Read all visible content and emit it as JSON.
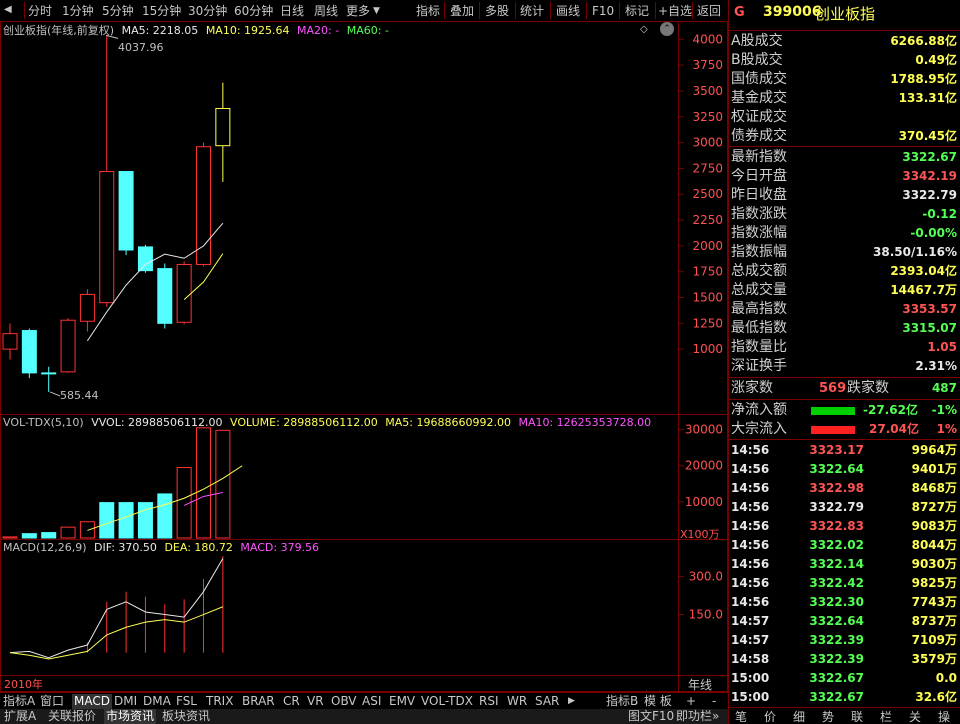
{
  "toolbar": {
    "left": [
      "分时",
      "1分钟",
      "5分钟",
      "15分钟",
      "30分钟",
      "60分钟",
      "日线",
      "周线",
      "更多"
    ],
    "right": [
      "指标",
      "叠加",
      "多股",
      "统计",
      "画线",
      "F10",
      "标记",
      "+自选",
      "返回"
    ]
  },
  "main_chart": {
    "title": "创业板指(年线,前复权)",
    "ma5": "MA5: 2218.05",
    "ma10": "MA10: 1925.64",
    "ma20": "MA20: -",
    "ma60": "MA60: -",
    "high_label": "4037.96",
    "low_label": "585.44",
    "y_ticks": [
      "4000",
      "3750",
      "3500",
      "3250",
      "3000",
      "2750",
      "2500",
      "2250",
      "2000",
      "1750",
      "1500",
      "1250",
      "1000"
    ]
  },
  "vol_chart": {
    "title": "VOL-TDX(5,10)",
    "vvol": "VVOL: 28988506112.00",
    "volume": "VOLUME: 28988506112.00",
    "ma5": "MA5: 19688660992.00",
    "ma10": "MA10: 12625353728.00",
    "y_ticks": [
      "30000",
      "20000",
      "10000"
    ],
    "unit": "X100万"
  },
  "macd_chart": {
    "title": "MACD(12,26,9)",
    "dif": "DIF: 370.50",
    "dea": "DEA: 180.72",
    "macd": "MACD: 379.56",
    "y_ticks": [
      "300.0",
      "150.0"
    ]
  },
  "x_axis": {
    "start_label": "2010年",
    "period_label": "年线"
  },
  "chart_data": [
    {
      "type": "candlestick",
      "title": "创业板指(年线,前复权)",
      "ylim": [
        585,
        4100
      ],
      "candles": [
        {
          "open": 1000,
          "high": 1250,
          "low": 900,
          "close": 1150,
          "color": "red"
        },
        {
          "open": 1180,
          "high": 1200,
          "low": 720,
          "close": 770,
          "color": "cyan"
        },
        {
          "open": 770,
          "high": 830,
          "low": 585.44,
          "close": 770,
          "color": "cyan"
        },
        {
          "open": 780,
          "high": 1300,
          "low": 770,
          "close": 1280,
          "color": "red"
        },
        {
          "open": 1270,
          "high": 1580,
          "low": 1170,
          "close": 1530,
          "color": "red"
        },
        {
          "open": 1450,
          "high": 4037.96,
          "low": 1410,
          "close": 2720,
          "color": "red"
        },
        {
          "open": 2720,
          "high": 2720,
          "low": 1910,
          "close": 1960,
          "color": "cyan"
        },
        {
          "open": 1990,
          "high": 2010,
          "low": 1740,
          "close": 1760,
          "color": "cyan"
        },
        {
          "open": 1780,
          "high": 1830,
          "low": 1200,
          "close": 1250,
          "color": "cyan"
        },
        {
          "open": 1260,
          "high": 1850,
          "low": 1240,
          "close": 1820,
          "color": "red"
        },
        {
          "open": 1820,
          "high": 3000,
          "low": 1800,
          "close": 2960,
          "color": "red"
        },
        {
          "open": 2970,
          "high": 3580,
          "low": 2620,
          "close": 3330,
          "color": "yellow"
        }
      ],
      "ma5_series": {
        "start_index": 4,
        "values": [
          1080,
          1360,
          1620,
          1820,
          1920,
          1880,
          2000,
          2220
        ]
      },
      "ma10_series": {
        "start_index": 9,
        "values": [
          1480,
          1650,
          1925
        ]
      }
    },
    {
      "type": "bar",
      "title": "VOL-TDX(5,10)",
      "ylim": [
        0,
        31000
      ],
      "values": [
        300,
        1200,
        1500,
        3000,
        4500,
        9800,
        9800,
        9800,
        12200,
        19500,
        30500,
        29800
      ],
      "colors": [
        "red",
        "cyan",
        "cyan",
        "red",
        "red",
        "cyan",
        "cyan",
        "cyan",
        "cyan",
        "red",
        "red",
        "red"
      ],
      "ma5_series": {
        "start_index": 4,
        "values": [
          2100,
          4000,
          5800,
          7800,
          9200,
          11000,
          13500,
          16500,
          20000
        ]
      },
      "ma10_series": {
        "start_index": 9,
        "values": [
          9000,
          11500,
          12600
        ]
      }
    },
    {
      "type": "macd",
      "title": "MACD(12,26,9)",
      "ylim": [
        -80,
        400
      ],
      "hist": [
        0,
        0,
        0,
        0,
        40,
        200,
        240,
        220,
        190,
        210,
        290,
        379.56
      ],
      "dif": [
        0,
        5,
        -20,
        10,
        30,
        170,
        200,
        160,
        150,
        140,
        240,
        370.5
      ],
      "dea": [
        0,
        -10,
        -25,
        -10,
        5,
        70,
        100,
        120,
        130,
        120,
        150,
        180.72
      ]
    }
  ],
  "right_panel": {
    "code_icon": "G",
    "code": "399006",
    "name": "创业板指",
    "turnover": [
      {
        "label": "A股成交",
        "value": "6266.88",
        "unit": "亿"
      },
      {
        "label": "B股成交",
        "value": "0.49",
        "unit": "亿"
      },
      {
        "label": "国债成交",
        "value": "1788.95",
        "unit": "亿"
      },
      {
        "label": "基金成交",
        "value": "133.31",
        "unit": "亿"
      },
      {
        "label": "权证成交",
        "value": "",
        "unit": ""
      },
      {
        "label": "债券成交",
        "value": "370.45",
        "unit": "亿"
      }
    ],
    "quote": [
      {
        "label": "最新指数",
        "value": "3322.67",
        "color": "#54ff54"
      },
      {
        "label": "今日开盘",
        "value": "3342.19",
        "color": "#ff5454"
      },
      {
        "label": "昨日收盘",
        "value": "3322.79",
        "color": "#e8e8e8"
      },
      {
        "label": "指数涨跌",
        "value": "-0.12",
        "color": "#54ff54"
      },
      {
        "label": "指数涨幅",
        "value": "-0.00%",
        "color": "#54ff54"
      },
      {
        "label": "指数振幅",
        "value": "38.50/1.16%",
        "color": "#e8e8e8"
      },
      {
        "label": "总成交额",
        "value": "2393.04亿",
        "color": "#ffff54"
      },
      {
        "label": "总成交量",
        "value": "14467.7万",
        "color": "#ffff54"
      },
      {
        "label": "最高指数",
        "value": "3353.57",
        "color": "#ff5454"
      },
      {
        "label": "最低指数",
        "value": "3315.07",
        "color": "#54ff54"
      },
      {
        "label": "指数量比",
        "value": "1.05",
        "color": "#ff5454"
      },
      {
        "label": "深证换手",
        "value": "2.31%",
        "color": "#e8e8e8"
      }
    ],
    "rise_label": "涨家数",
    "rise_value": "569",
    "fall_label": "跌家数",
    "fall_value": "487",
    "net_flow_label": "净流入额",
    "net_flow_value": "-27.62亿",
    "net_flow_pct": "-1%",
    "block_flow_label": "大宗流入",
    "block_flow_value": "27.04亿",
    "block_flow_pct": "1%",
    "ticks": [
      {
        "time": "14:56",
        "price": "3323.17",
        "vol": "9964万",
        "color": "#ff5454"
      },
      {
        "time": "14:56",
        "price": "3322.64",
        "vol": "9401万",
        "color": "#54ff54"
      },
      {
        "time": "14:56",
        "price": "3322.98",
        "vol": "8468万",
        "color": "#ff5454"
      },
      {
        "time": "14:56",
        "price": "3322.79",
        "vol": "8727万",
        "color": "#e8e8e8"
      },
      {
        "time": "14:56",
        "price": "3322.83",
        "vol": "9083万",
        "color": "#ff5454"
      },
      {
        "time": "14:56",
        "price": "3322.02",
        "vol": "8044万",
        "color": "#54ff54"
      },
      {
        "time": "14:56",
        "price": "3322.14",
        "vol": "9030万",
        "color": "#54ff54"
      },
      {
        "time": "14:56",
        "price": "3322.42",
        "vol": "9825万",
        "color": "#54ff54"
      },
      {
        "time": "14:56",
        "price": "3322.30",
        "vol": "7743万",
        "color": "#54ff54"
      },
      {
        "time": "14:57",
        "price": "3322.64",
        "vol": "8737万",
        "color": "#54ff54"
      },
      {
        "time": "14:57",
        "price": "3322.39",
        "vol": "7109万",
        "color": "#54ff54"
      },
      {
        "time": "14:58",
        "price": "3322.39",
        "vol": "3579万",
        "color": "#54ff54"
      },
      {
        "time": "15:00",
        "price": "3322.67",
        "vol": "0.0",
        "color": "#54ff54"
      },
      {
        "time": "15:00",
        "price": "3322.67",
        "vol": "32.6亿",
        "color": "#54ff54"
      }
    ],
    "bottom_tabs": [
      "笔",
      "价",
      "细",
      "势",
      "联",
      "栏",
      "关",
      "操"
    ]
  },
  "indicator_tabs": {
    "items": [
      "指标A",
      "窗口",
      "MACD",
      "DMI",
      "DMA",
      "FSL",
      "TRIX",
      "BRAR",
      "CR",
      "VR",
      "OBV",
      "ASI",
      "EMV",
      "VOL-TDX",
      "RSI",
      "WR",
      "SAR"
    ],
    "right_items": [
      "指标B",
      "模 板"
    ],
    "plus": "+",
    "minus": "-"
  },
  "bottom_tabs": [
    "扩展A",
    "关联报价",
    "市场资讯",
    "板块资讯"
  ],
  "bottom_right": [
    "图文F10",
    "即功栏»"
  ]
}
